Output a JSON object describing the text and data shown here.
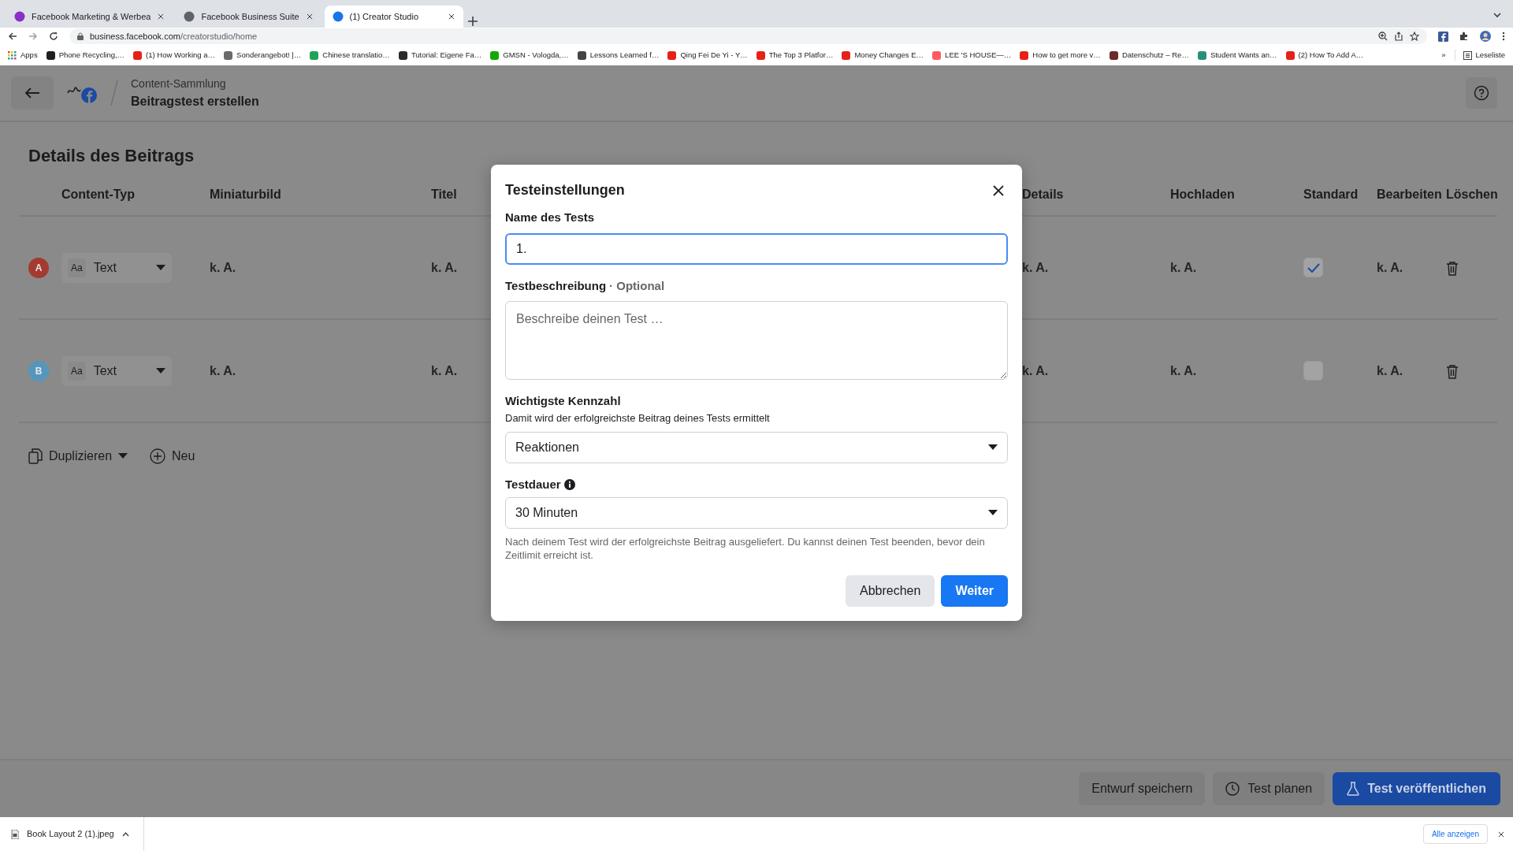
{
  "browser": {
    "tabs": [
      {
        "title": "Facebook Marketing & Werbea",
        "selected": false,
        "color": "#8b2fc9"
      },
      {
        "title": "Facebook Business Suite",
        "selected": false,
        "color": "#5f6368"
      },
      {
        "title": "(1) Creator Studio",
        "selected": true,
        "color": "#1a73e8"
      }
    ],
    "url": {
      "host": "business.facebook.com",
      "path": "/creatorstudio/home"
    },
    "bookmarks": [
      {
        "kind": "apps",
        "label": "Apps"
      },
      {
        "kind": "site",
        "label": "Phone Recycling,…",
        "color": "#1f1f1f"
      },
      {
        "kind": "site",
        "label": "(1) How Working a…",
        "color": "#e62117"
      },
      {
        "kind": "site",
        "label": "Sonderangebot! |…",
        "color": "#6b6b6b"
      },
      {
        "kind": "site",
        "label": "Chinese translatio…",
        "color": "#20a35a"
      },
      {
        "kind": "site",
        "label": "Tutorial: Eigene Fa…",
        "color": "#2b2b2b"
      },
      {
        "kind": "site",
        "label": "GMSN - Vologda,…",
        "color": "#14a800"
      },
      {
        "kind": "site",
        "label": "Lessons Learned f…",
        "color": "#444444"
      },
      {
        "kind": "site",
        "label": "Qing Fei De Yi - Y…",
        "color": "#e62117"
      },
      {
        "kind": "site",
        "label": "The Top 3 Platfor…",
        "color": "#e62117"
      },
      {
        "kind": "site",
        "label": "Money Changes E…",
        "color": "#e62117"
      },
      {
        "kind": "site",
        "label": "LEE 'S HOUSE—…",
        "color": "#ff5a5f"
      },
      {
        "kind": "site",
        "label": "How to get more v…",
        "color": "#e62117"
      },
      {
        "kind": "site",
        "label": "Datenschutz – Re…",
        "color": "#6a2a2a"
      },
      {
        "kind": "site",
        "label": "Student Wants an…",
        "color": "#2a8f7a"
      },
      {
        "kind": "site",
        "label": "(2) How To Add A…",
        "color": "#e62117"
      }
    ],
    "overflow": "»",
    "reading_list": "Leseliste"
  },
  "header": {
    "breadcrumb": "Content-Sammlung",
    "title": "Beitragstest erstellen"
  },
  "section_title": "Details des Beitrags",
  "table": {
    "columns": [
      "Content-Typ",
      "Miniaturbild",
      "Titel",
      "Details",
      "Hochladen",
      "Standard",
      "Bearbeiten",
      "Löschen"
    ],
    "rows": [
      {
        "variant": "A",
        "color": "#a43a30",
        "type_icon": "Aa",
        "content_type": "Text",
        "thumbnail": "k. A.",
        "title": "k. A.",
        "details": "k. A.",
        "upload": "k. A.",
        "standard": true,
        "edit": "k. A."
      },
      {
        "variant": "B",
        "color": "#5596bd",
        "type_icon": "Aa",
        "content_type": "Text",
        "thumbnail": "k. A.",
        "title": "k. A.",
        "details": "k. A.",
        "upload": "k. A.",
        "standard": false,
        "edit": "k. A."
      }
    ]
  },
  "actions": {
    "duplicate": "Duplizieren",
    "new": "Neu"
  },
  "footer_buttons": [
    {
      "kind": "secondary",
      "label": "Entwurf speichern"
    },
    {
      "kind": "clock",
      "label": "Test planen"
    },
    {
      "kind": "primary",
      "label": "Test veröffentlichen"
    }
  ],
  "dialog": {
    "title": "Testeinstellungen",
    "name": {
      "label": "Name des Tests",
      "value": "1."
    },
    "description": {
      "label": "Testbeschreibung",
      "note": "· Optional",
      "placeholder": "Beschreibe deinen Test …"
    },
    "metric": {
      "label": "Wichtigste Kennzahl",
      "help": "Damit wird der erfolgreichste Beitrag deines Tests ermittelt",
      "value": "Reaktionen"
    },
    "duration": {
      "label": "Testdauer",
      "value": "30 Minuten",
      "hint": "Nach deinem Test wird der erfolgreichste Beitrag ausgeliefert. Du kannst deinen Test beenden, bevor dein Zeitlimit erreicht ist."
    },
    "cancel": "Abbrechen",
    "next": "Weiter"
  },
  "download": {
    "file": "Book Layout 2 (1).jpeg",
    "show_all": "Alle anzeigen"
  }
}
